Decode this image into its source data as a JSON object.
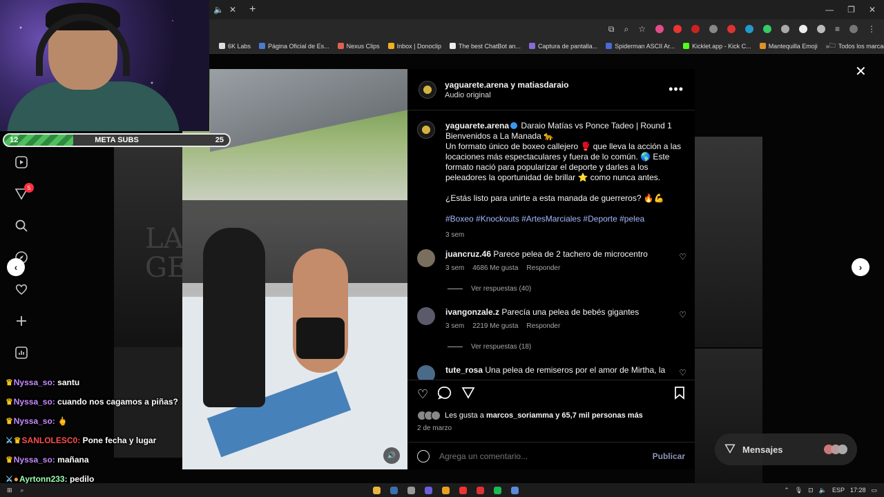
{
  "stream": {
    "sub_goal": {
      "current": "12",
      "label": "META SUBS",
      "target": "25"
    },
    "chat": [
      {
        "user": "Nyssa_so:",
        "message": "santu",
        "user_color": "#c78bff"
      },
      {
        "user": "Nyssa_so:",
        "message": "cuando nos cagamos a piñas?",
        "user_color": "#c78bff"
      },
      {
        "user": "Nyssa_so:",
        "message": "🖕",
        "user_color": "#c78bff"
      },
      {
        "user": "SANLOLESC0:",
        "message": "Pone fecha y lugar",
        "user_color": "#ff4d4d"
      },
      {
        "user": "Nyssa_so:",
        "message": "mañana",
        "user_color": "#c78bff"
      },
      {
        "user": "Ayrtonn233:",
        "message": "pedilo",
        "user_color": "#9bffb0"
      }
    ]
  },
  "browser": {
    "bookmarks": [
      {
        "label": "6K Labs",
        "color": "#dddddd"
      },
      {
        "label": "Página Oficial de Es...",
        "color": "#4a7bd0"
      },
      {
        "label": "Nexus Clips",
        "color": "#e06050"
      },
      {
        "label": "Inbox | Donoclip",
        "color": "#f0b020"
      },
      {
        "label": "The best ChatBot an...",
        "color": "#eeeeee"
      },
      {
        "label": "Captura de pantalla...",
        "color": "#8a6ad8"
      },
      {
        "label": "Spiderman ASCII Ar...",
        "color": "#4a6ad8"
      },
      {
        "label": "Kicklet.app - Kick C...",
        "color": "#53fc18"
      },
      {
        "label": "Mantequilla Emoji",
        "color": "#e0902a"
      }
    ],
    "bookmarks_folder": "Todos los marcadores"
  },
  "instagram": {
    "header": {
      "authors": "yaguarete.arena y matiasdaraio",
      "audio": "Audio original"
    },
    "caption": {
      "user": "yaguarete.arena",
      "title": "Daraio Matías vs Ponce Tadeo | Round 1",
      "line2": "Bienvenidos a La Manada 🐆",
      "body": "Un formato único de boxeo callejero 🥊 que lleva la acción a las locaciones más espectaculares y fuera de lo común. 🌎 Este formato nació para popularizar el deporte y darles a los peleadores la oportunidad de brillar ⭐ como nunca antes.",
      "question": "¿Estás listo para unirte a esta manada de guerreros? 🔥💪",
      "hashtags": "#Boxeo #Knockouts #ArtesMarciales #Deporte #pelea",
      "time": "3 sem"
    },
    "comments": [
      {
        "user": "juancruz.46",
        "text": "Parece pelea de 2 tachero de microcentro",
        "time": "3 sem",
        "likes": "4686 Me gusta",
        "reply": "Responder",
        "view_replies": "Ver respuestas (40)"
      },
      {
        "user": "ivangonzale.z",
        "text": "Parecía una pelea de bebés gigantes",
        "time": "3 sem",
        "likes": "2219 Me gusta",
        "reply": "Responder",
        "view_replies": "Ver respuestas (18)"
      },
      {
        "user": "tute_rosa",
        "text": "Una pelea de remiseros por el amor de Mirtha, la"
      }
    ],
    "likes": {
      "prefix": "Les gusta a",
      "user": "marcos_soriamma",
      "suffix": "y 65,7 mil personas más"
    },
    "date": "2 de marzo",
    "compose": {
      "placeholder": "Agrega un comentario...",
      "publish": "Publicar"
    },
    "messages_label": "Mensajes",
    "notification_count": "5",
    "background_text": "LA M\nGENT"
  },
  "taskbar": {
    "lang": "ESP",
    "time": "17:28"
  }
}
